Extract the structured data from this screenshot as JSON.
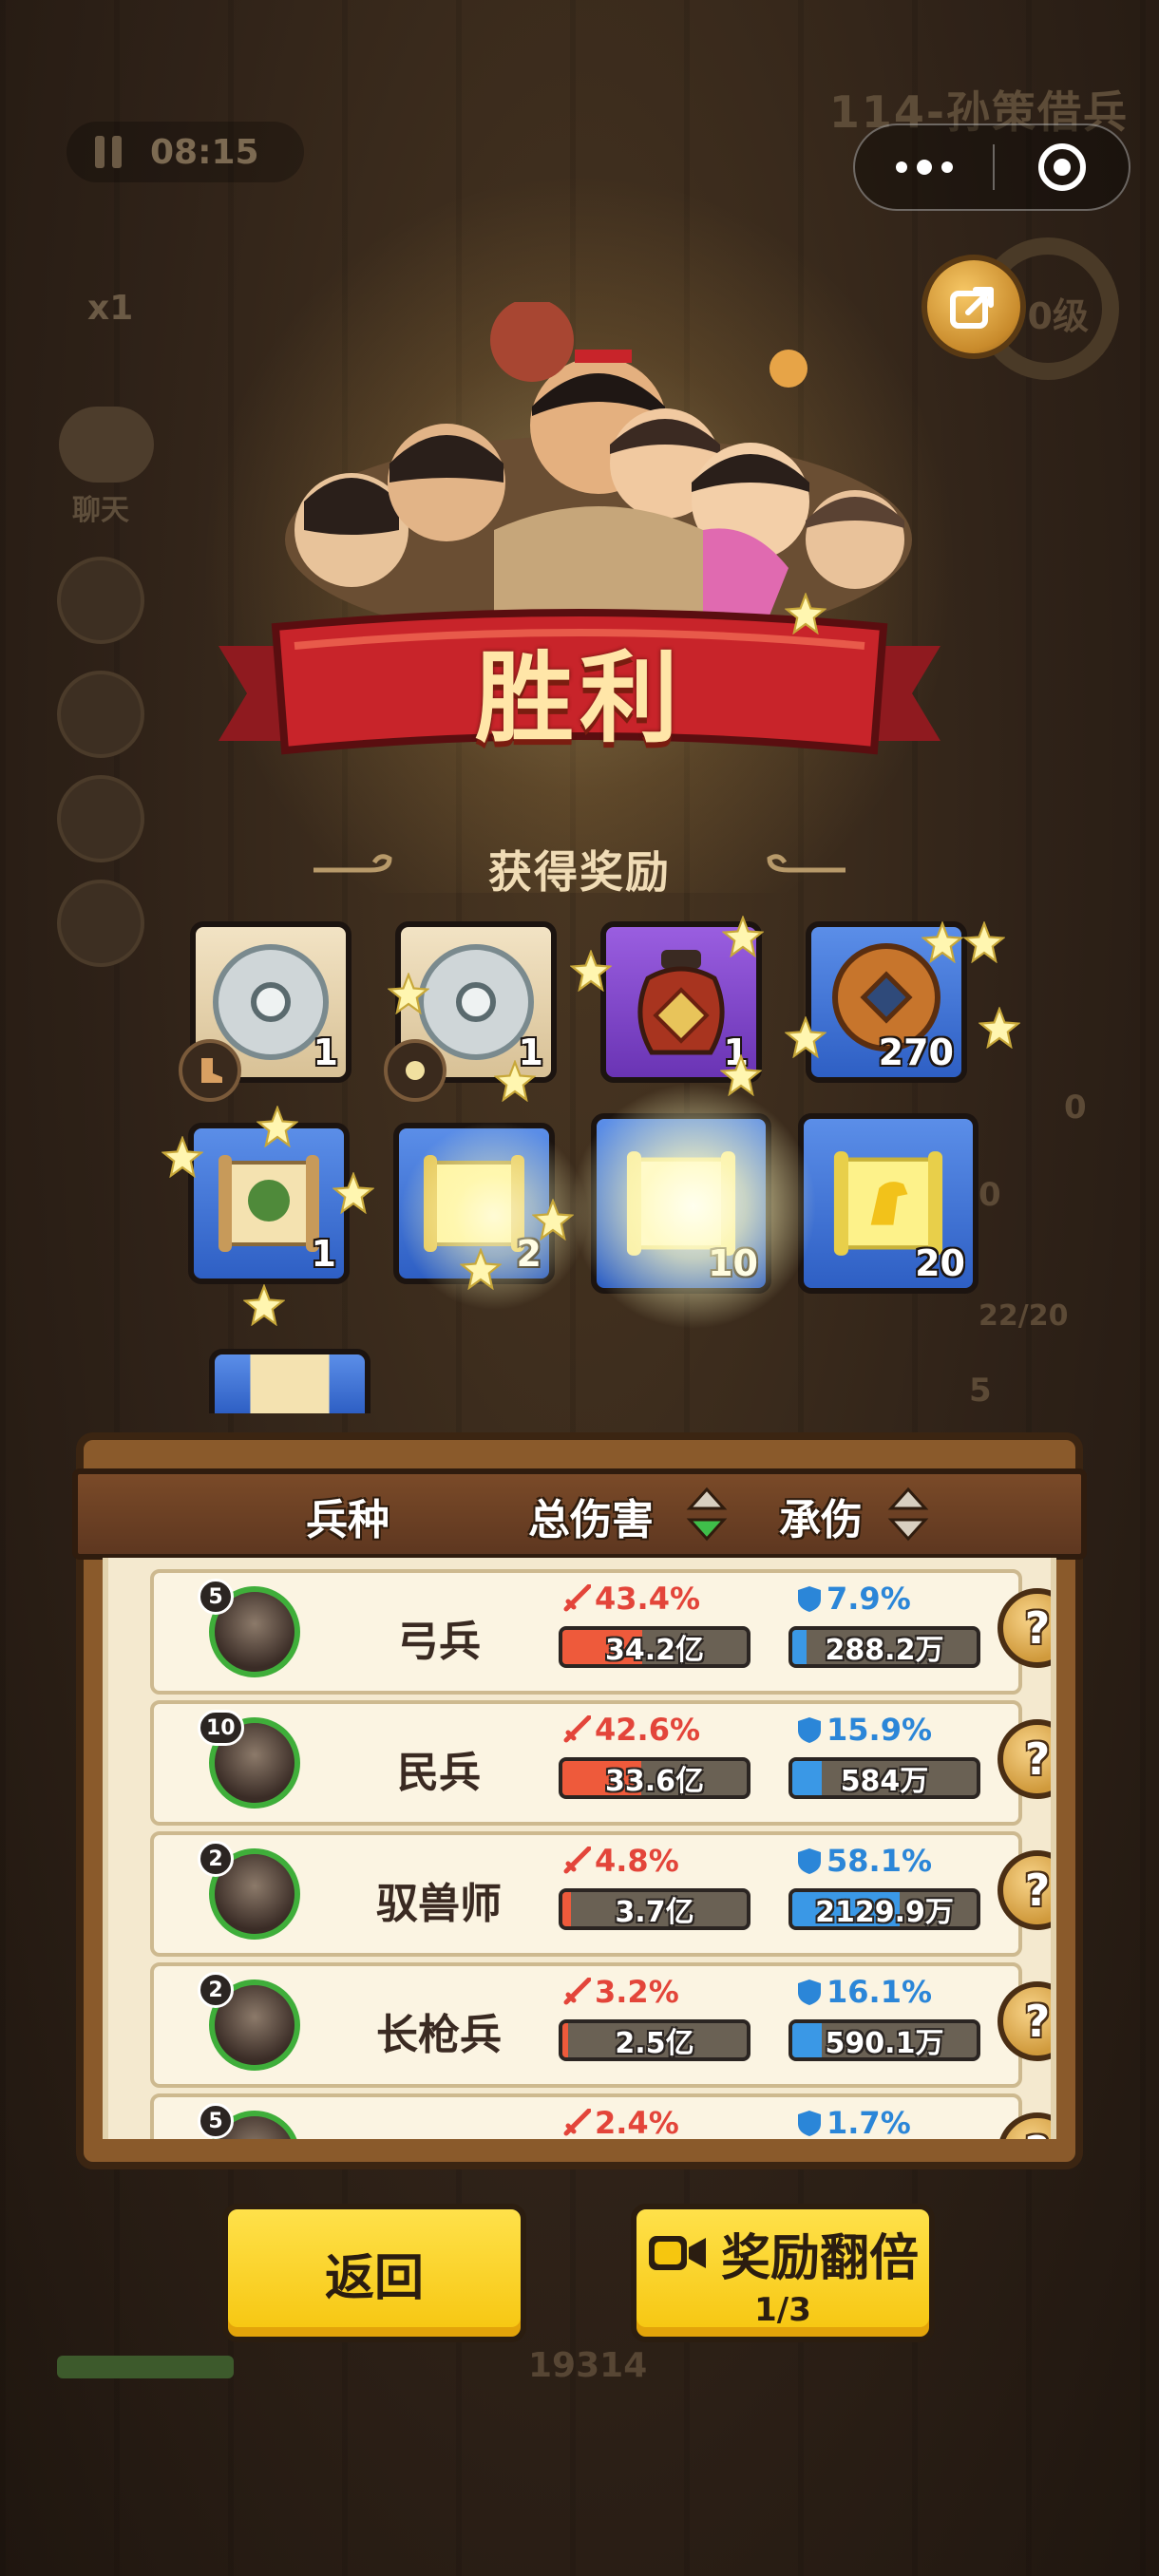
{
  "background": {
    "timer": "08:15",
    "level_title": "114-孙策借兵",
    "speed": "x1",
    "chat_label": "聊天",
    "ring_label": "0级",
    "score": "19314",
    "side_numbers": [
      "0",
      "0",
      "22/20",
      "5"
    ]
  },
  "result": {
    "title": "胜利",
    "rewards_heading": "获得奖励"
  },
  "rewards": [
    {
      "icon": "silver-disc-icon",
      "count": "1"
    },
    {
      "icon": "silver-disc-icon",
      "count": "1"
    },
    {
      "icon": "wine-jar-icon",
      "count": "1"
    },
    {
      "icon": "bronze-coin-icon",
      "count": "270"
    },
    {
      "icon": "scroll-icon",
      "count": "1"
    },
    {
      "icon": "scroll-icon",
      "count": "2"
    },
    {
      "icon": "scroll-icon",
      "count": "10"
    },
    {
      "icon": "horse-scroll-icon",
      "count": "20"
    }
  ],
  "stats": {
    "headers": {
      "unit": "兵种",
      "damage": "总伤害",
      "taken": "承伤"
    },
    "rows": [
      {
        "level": "5",
        "name": "弓兵",
        "damage_pct": "43.4%",
        "damage_val": "34.2亿",
        "damage_fill": 0.434,
        "taken_pct": "7.9%",
        "taken_val": "288.2万",
        "taken_fill": 0.079
      },
      {
        "level": "10",
        "name": "民兵",
        "damage_pct": "42.6%",
        "damage_val": "33.6亿",
        "damage_fill": 0.426,
        "taken_pct": "15.9%",
        "taken_val": "584万",
        "taken_fill": 0.159
      },
      {
        "level": "2",
        "name": "驭兽师",
        "damage_pct": "4.8%",
        "damage_val": "3.7亿",
        "damage_fill": 0.048,
        "taken_pct": "58.1%",
        "taken_val": "2129.9万",
        "taken_fill": 0.581
      },
      {
        "level": "2",
        "name": "长枪兵",
        "damage_pct": "3.2%",
        "damage_val": "2.5亿",
        "damage_fill": 0.032,
        "taken_pct": "16.1%",
        "taken_val": "590.1万",
        "taken_fill": 0.161
      },
      {
        "level": "5",
        "name": "",
        "damage_pct": "2.4%",
        "damage_val": "",
        "damage_fill": 0.024,
        "taken_pct": "1.7%",
        "taken_val": "",
        "taken_fill": 0.017
      }
    ],
    "help_label": "?"
  },
  "buttons": {
    "back": "返回",
    "double": "奖励翻倍",
    "double_count": "1/3"
  },
  "colors": {
    "accent_yellow": "#f6c60f",
    "damage_red": "#ee5a3b",
    "tank_blue": "#3a98e6",
    "banner_red": "#c8242a"
  }
}
